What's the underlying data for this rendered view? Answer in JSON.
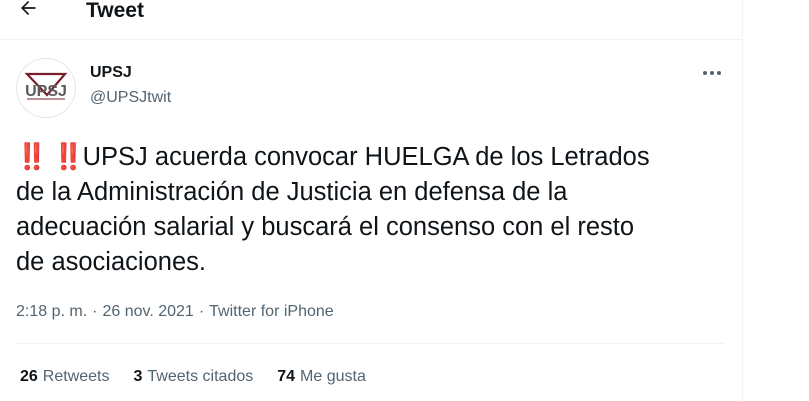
{
  "header": {
    "title": "Tweet",
    "back_icon": "arrow-left-icon"
  },
  "author": {
    "name": "UPSJ",
    "handle": "@UPSJtwit",
    "avatar_text": "UPSJ"
  },
  "tweet": {
    "alarm_emoji": "‼️",
    "alarm_emoji_2": "‼️",
    "text_line1": "UPSJ acuerda convocar HUELGA de los Letrados",
    "text_line2": "de la Administración de Justicia en defensa de la",
    "text_line3": "adecuación salarial y buscará el consenso con el resto",
    "text_line4": "de asociaciones.",
    "time": "2:18 p. m.",
    "date": "26 nov. 2021",
    "separator": "·",
    "source": "Twitter for iPhone"
  },
  "stats": {
    "retweets_count": "26",
    "retweets_label": "Retweets",
    "quotes_count": "3",
    "quotes_label": "Tweets citados",
    "likes_count": "74",
    "likes_label": "Me gusta"
  },
  "colors": {
    "text": "#0f1419",
    "secondary": "#536471",
    "alarm": "#e0182b",
    "border": "#eff3f4"
  }
}
